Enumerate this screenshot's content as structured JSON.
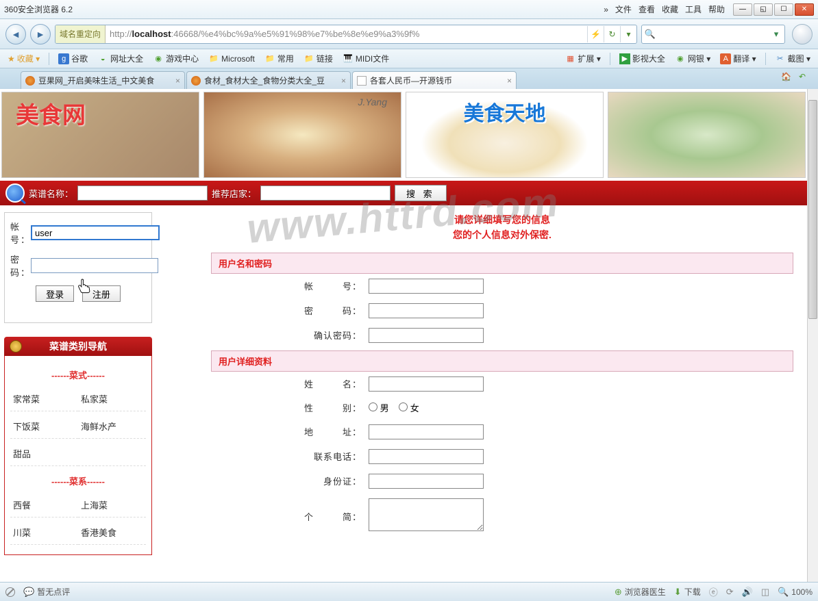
{
  "titlebar": {
    "title": "360安全浏览器 6.2",
    "chev": "»",
    "menu": [
      "文件",
      "查看",
      "收藏",
      "工具",
      "帮助"
    ]
  },
  "nav": {
    "redirect": "域名重定向",
    "url_prefix": "http://",
    "url_host": "localhost",
    "url_rest": ":46668/%e4%bc%9a%e5%91%98%e7%be%8e%e9%a3%9f%"
  },
  "bookmarks": {
    "fav": "收藏 ▾",
    "items": [
      "谷歌",
      "网址大全",
      "游戏中心",
      "Microsoft",
      "常用",
      "链接",
      "MIDI文件"
    ],
    "right": [
      "扩展 ▾",
      "影视大全",
      "网银 ▾",
      "翻译 ▾",
      "截图 ▾"
    ]
  },
  "tabs": [
    {
      "label": "豆果网_开启美味生活_中文美食"
    },
    {
      "label": "食材_食材大全_食物分类大全_豆"
    },
    {
      "label": "各套人民币—开源钱币"
    }
  ],
  "banner": {
    "t1": "美食网",
    "t2": "J.Yang",
    "t3": "美食天地"
  },
  "redbar": {
    "lbl1": "菜谱名称：",
    "lbl2": "推荐店家：",
    "btn": "搜 索"
  },
  "login": {
    "lbl_user": "帐　号：",
    "lbl_pass": "密　码：",
    "val_user": "user",
    "btn_login": "登录",
    "btn_reg": "注册"
  },
  "catnav": {
    "title": "菜谱类别导航",
    "group1": "------菜式------",
    "items1": [
      "家常菜",
      "私家菜",
      "下饭菜",
      "海鲜水产",
      "甜品",
      ""
    ],
    "group2": "------菜系------",
    "items2": [
      "西餐",
      "上海菜",
      "川菜",
      "香港美食"
    ]
  },
  "form": {
    "title1": "请您详细填写您的信息",
    "title2": "您的个人信息对外保密.",
    "section1": "用户名和密码",
    "f_user": "帐　　　号：",
    "f_pass": "密　　　码：",
    "f_pass2": "确认密码：",
    "section2": "用户详细资料",
    "f_name": "姓　　　名：",
    "f_sex": "性　　　别：",
    "sex_m": "男",
    "sex_f": "女",
    "f_addr": "地　　　址：",
    "f_tel": "联系电话：",
    "f_id": "身份证：",
    "f_intro": "个　　　简："
  },
  "watermark": "www.httrd.com",
  "status": {
    "left1": "暂无点评",
    "doctor": "浏览器医生",
    "download": "下载",
    "zoom": "100%"
  }
}
